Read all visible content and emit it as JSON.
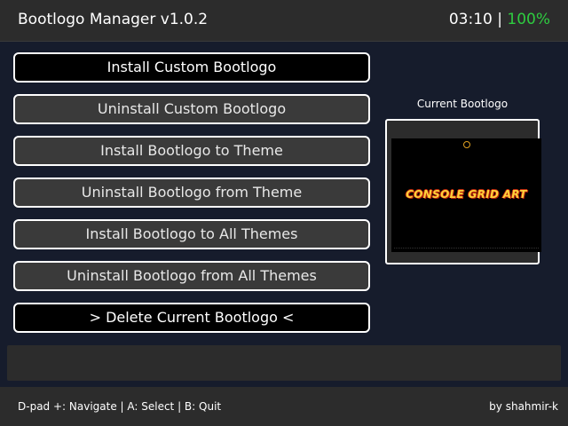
{
  "header": {
    "title": "Bootlogo Manager v1.0.2",
    "time": "03:10",
    "separator": " | ",
    "battery": "100%",
    "battery_color": "#2ecc40"
  },
  "menu": {
    "selected_index": 0,
    "items": [
      {
        "label": "Install Custom Bootlogo"
      },
      {
        "label": "Uninstall Custom Bootlogo"
      },
      {
        "label": "Install Bootlogo to Theme"
      },
      {
        "label": "Uninstall Bootlogo from Theme"
      },
      {
        "label": "Install Bootlogo to All Themes"
      },
      {
        "label": "Uninstall Bootlogo from All Themes"
      },
      {
        "label": "> Delete Current Bootlogo <"
      }
    ]
  },
  "preview": {
    "label": "Current Bootlogo",
    "logo_text": "CONSOLE GRID ART"
  },
  "message_bar": {
    "text": ""
  },
  "footer": {
    "help": "D-pad +: Navigate | A: Select | B: Quit",
    "author": "by shahmir-k"
  }
}
